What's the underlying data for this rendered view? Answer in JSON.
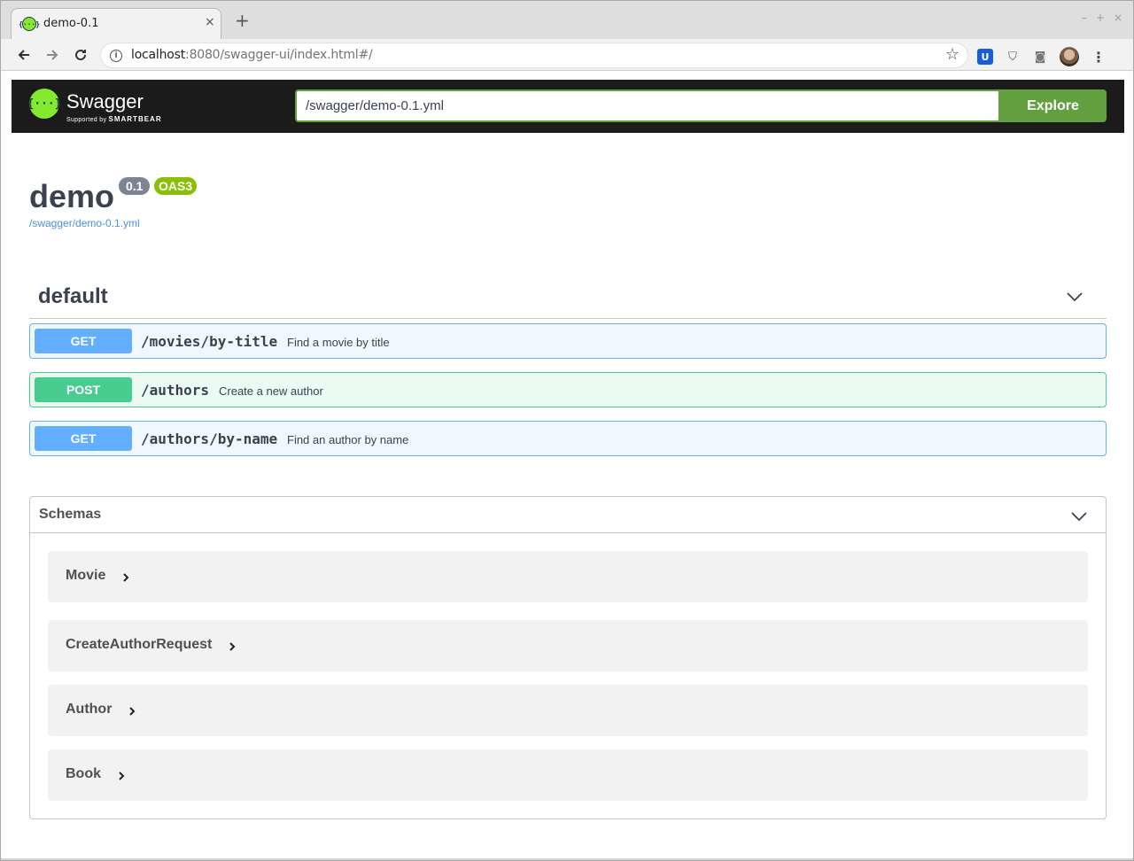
{
  "browser": {
    "tab_title": "demo-0.1",
    "tab_favicon": "{···}",
    "close_glyph": "×",
    "new_tab_glyph": "+",
    "window_controls": [
      "–",
      "+",
      "×"
    ],
    "url_host": "localhost",
    "url_rest": ":8080/swagger-ui/index.html#/",
    "info_glyph": "i",
    "star_glyph": "☆",
    "bitwarden_glyph": "U",
    "pocket_glyph": "⛉",
    "camera_glyph": "◙",
    "menu_glyph": "⋮"
  },
  "topbar": {
    "logo_icon": "{···}",
    "logo_text": "Swagger",
    "logo_sub_prefix": "Supported by ",
    "logo_sub_brand": "SMARTBEAR",
    "spec_url": "/swagger/demo-0.1.yml",
    "explore_label": "Explore",
    "brand_color": "#85ea2d",
    "button_color": "#62a03f"
  },
  "info": {
    "title": "demo",
    "version": "0.1",
    "oas": "OAS3",
    "spec_link": "/swagger/demo-0.1.yml"
  },
  "tag": {
    "name": "default"
  },
  "operations": [
    {
      "method": "GET",
      "path": "/movies/by-title",
      "summary": "Find a movie by title",
      "color": "#61affe"
    },
    {
      "method": "POST",
      "path": "/authors",
      "summary": "Create a new author",
      "color": "#49cc90"
    },
    {
      "method": "GET",
      "path": "/authors/by-name",
      "summary": "Find an author by name",
      "color": "#61affe"
    }
  ],
  "schemas": {
    "title": "Schemas",
    "models": [
      "Movie",
      "CreateAuthorRequest",
      "Author",
      "Book"
    ]
  }
}
